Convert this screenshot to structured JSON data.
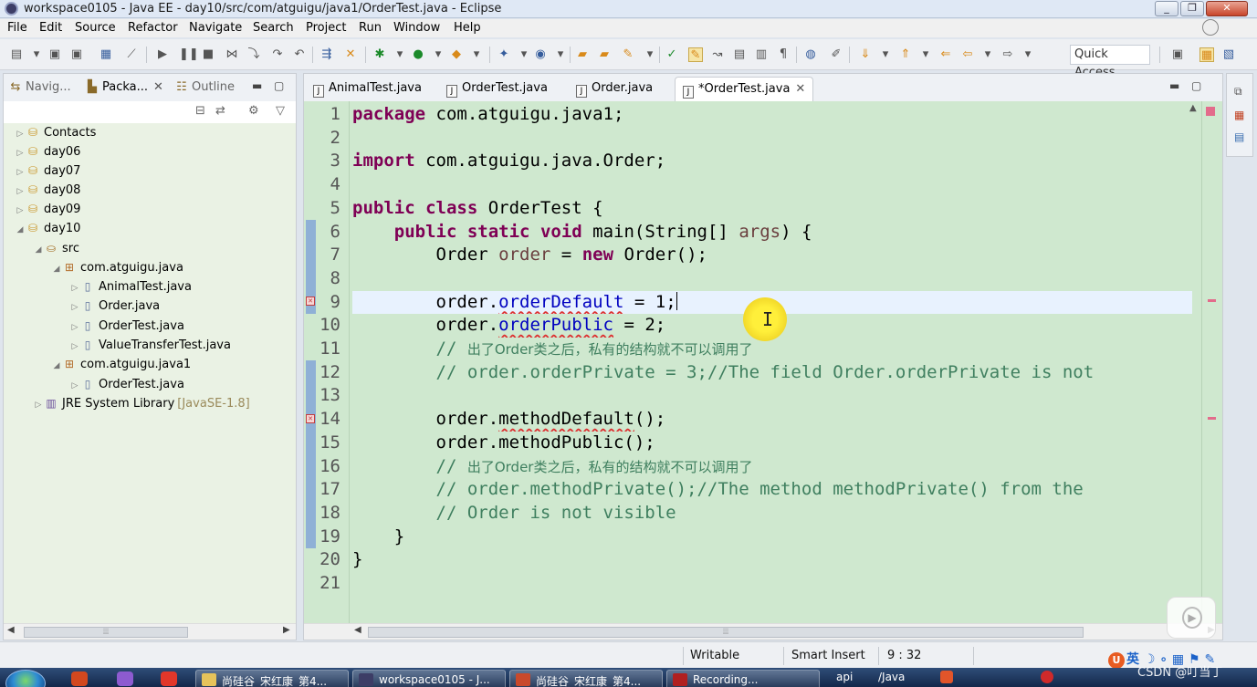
{
  "window": {
    "title": "workspace0105 - Java EE - day10/src/com/atguigu/java1/OrderTest.java - Eclipse",
    "min_glyph": "_",
    "max_glyph": "❐",
    "close_glyph": "✕"
  },
  "menu": [
    "File",
    "Edit",
    "Source",
    "Refactor",
    "Navigate",
    "Search",
    "Project",
    "Run",
    "Window",
    "Help"
  ],
  "toolbar": {
    "quick_access": "Quick Access"
  },
  "left_view": {
    "tabs": [
      {
        "label": "Navig...",
        "icon": "navigator-icon"
      },
      {
        "label": "Packa...",
        "icon": "package-explorer-icon",
        "close": "✕"
      },
      {
        "label": "Outline",
        "icon": "outline-icon"
      }
    ],
    "tree": [
      {
        "label": "Contacts",
        "arrow": "▷",
        "icon": "project-icon"
      },
      {
        "label": "day06",
        "arrow": "▷",
        "icon": "project-icon"
      },
      {
        "label": "day07",
        "arrow": "▷",
        "icon": "project-icon"
      },
      {
        "label": "day08",
        "arrow": "▷",
        "icon": "project-icon"
      },
      {
        "label": "day09",
        "arrow": "▷",
        "icon": "project-icon"
      },
      {
        "label": "day10",
        "arrow": "◢",
        "icon": "project-icon"
      },
      {
        "label": "src",
        "arrow": "◢",
        "icon": "source-folder-icon"
      },
      {
        "label": "com.atguigu.java",
        "arrow": "◢",
        "icon": "package-icon"
      },
      {
        "label": "AnimalTest.java",
        "arrow": "▷",
        "icon": "java-file-icon"
      },
      {
        "label": "Order.java",
        "arrow": "▷",
        "icon": "java-file-icon"
      },
      {
        "label": "OrderTest.java",
        "arrow": "▷",
        "icon": "java-file-icon"
      },
      {
        "label": "ValueTransferTest.java",
        "arrow": "▷",
        "icon": "java-file-icon"
      },
      {
        "label": "com.atguigu.java1",
        "arrow": "◢",
        "icon": "package-icon"
      },
      {
        "label": "OrderTest.java",
        "arrow": "▷",
        "icon": "java-file-icon"
      },
      {
        "label": "JRE System Library",
        "extra": "[JavaSE-1.8]",
        "arrow": "▷",
        "icon": "library-icon"
      }
    ]
  },
  "editor": {
    "tabs": [
      {
        "label": "AnimalTest.java"
      },
      {
        "label": "OrderTest.java"
      },
      {
        "label": "Order.java"
      },
      {
        "label": "*OrderTest.java",
        "active": true,
        "close": "✕"
      }
    ],
    "line_numbers": [
      "1",
      "2",
      "3",
      "4",
      "5",
      "6",
      "7",
      "8",
      "9",
      "10",
      "11",
      "12",
      "13",
      "14",
      "15",
      "16",
      "17",
      "18",
      "19",
      "20",
      "21"
    ],
    "code": {
      "l1_kw": "package",
      "l1_rest": " com.atguigu.java1;",
      "l3_kw": "import",
      "l3_rest": " com.atguigu.java.Order;",
      "l5_kw1": "public",
      "l5_kw2": "class",
      "l5_rest": " OrderTest {",
      "l6_indent": "    ",
      "l6_kw1": "public",
      "l6_kw2": "static",
      "l6_kw3": "void",
      "l6_mid": " main(String[] ",
      "l6_param": "args",
      "l6_end": ") {",
      "l7_pre": "        Order ",
      "l7_var": "order",
      "l7_mid": " = ",
      "l7_kw": "new",
      "l7_end": " Order();",
      "l9_pre": "        order.",
      "l9_field": "orderDefault",
      "l9_end": " = 1;",
      "l10_pre": "        order.",
      "l10_field": "orderPublic",
      "l10_end": " = 2;",
      "l11_pre": "        // ",
      "l11_cjk": "出了Order类之后，私有的结构就不可以调用了",
      "l12": "        // order.orderPrivate = 3;//The field Order.orderPrivate is not",
      "l14_pre": "        order.",
      "l14_err": "methodDefault",
      "l14_end": "();",
      "l15": "        order.methodPublic();",
      "l16_pre": "        // ",
      "l16_cjk": "出了Order类之后，私有的结构就不可以调用了",
      "l17": "        // order.methodPrivate();//The method methodPrivate() from the",
      "l18": "        // Order is not visible",
      "l19": "    }",
      "l20": "}"
    }
  },
  "status": {
    "mode": "Writable",
    "insert": "Smart Insert",
    "position": "9 : 32",
    "ime": "英"
  },
  "taskbar": {
    "items": [
      "尚硅谷_宋红康_第4...",
      "workspace0105 - J...",
      "尚硅谷_宋红康_第4...",
      "Recording..."
    ],
    "tray_text": "api",
    "tray_label": "/Java"
  },
  "watermark": "CSDN @叮当丁"
}
